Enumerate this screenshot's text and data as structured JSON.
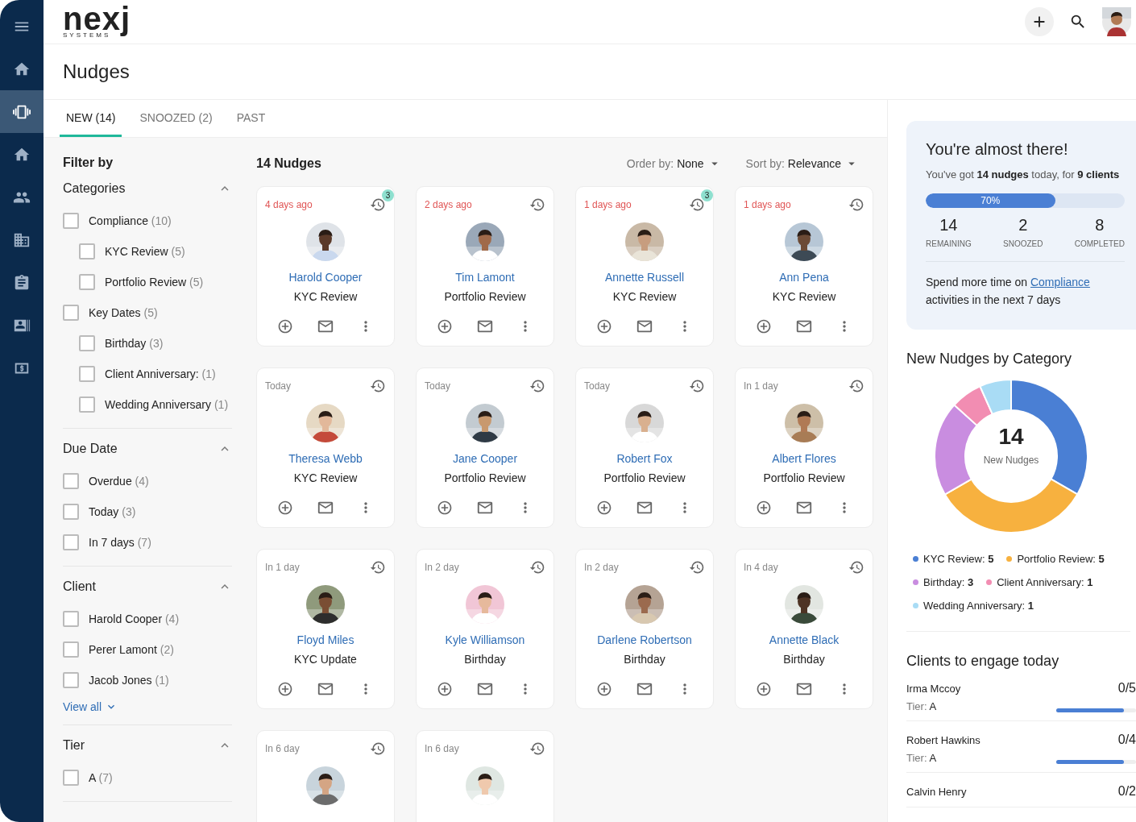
{
  "logo": {
    "word": "nexj",
    "tagline": "SYSTEMS"
  },
  "sidebar": {
    "items": [
      {
        "selected": false
      },
      {
        "selected": true
      },
      {
        "selected": false
      },
      {
        "selected": false
      },
      {
        "selected": false
      },
      {
        "selected": false
      },
      {
        "selected": false
      },
      {
        "selected": false
      }
    ]
  },
  "page_title": "Nudges",
  "tabs": [
    {
      "label": "NEW (14)",
      "selected": true
    },
    {
      "label": "SNOOZED (2)",
      "selected": false
    },
    {
      "label": "PAST",
      "selected": false
    }
  ],
  "filters": {
    "title": "Filter by",
    "sections": [
      {
        "title": "Categories",
        "expanded": true,
        "items": [
          {
            "label": "Compliance",
            "count": "(10)",
            "checked": false,
            "children": [
              {
                "label": "KYC Review",
                "count": "(5)",
                "checked": false
              },
              {
                "label": "Portfolio Review",
                "count": "(5)",
                "checked": false
              }
            ]
          },
          {
            "label": "Key Dates",
            "count": "(5)",
            "checked": false,
            "children": [
              {
                "label": "Birthday",
                "count": "(3)",
                "checked": false
              },
              {
                "label": "Client Anniversary:",
                "count": "(1)",
                "checked": false
              },
              {
                "label": "Wedding Anniversary",
                "count": "(1)",
                "checked": false
              }
            ]
          }
        ]
      },
      {
        "title": "Due Date",
        "expanded": true,
        "items": [
          {
            "label": "Overdue",
            "count": "(4)",
            "checked": false
          },
          {
            "label": "Today",
            "count": "(3)",
            "checked": false
          },
          {
            "label": "In 7 days",
            "count": "(7)",
            "checked": false
          }
        ]
      },
      {
        "title": "Client",
        "expanded": true,
        "items": [
          {
            "label": "Harold Cooper",
            "count": "(4)",
            "checked": false
          },
          {
            "label": "Perer Lamont",
            "count": "(2)",
            "checked": false
          },
          {
            "label": "Jacob Jones",
            "count": "(1)",
            "checked": false
          }
        ],
        "view_all": "View all"
      },
      {
        "title": "Tier",
        "expanded": true,
        "items": [
          {
            "label": "A",
            "count": "(7)",
            "checked": false
          }
        ]
      }
    ]
  },
  "nudges": {
    "title": "14 Nudges",
    "order_label": "Order by:",
    "order_value": "None",
    "sort_label": "Sort by:",
    "sort_value": "Relevance",
    "cards": [
      {
        "due": "4 days ago",
        "overdue": true,
        "badge": "3",
        "name": "Harold Cooper",
        "type": "KYC Review"
      },
      {
        "due": "2 days ago",
        "overdue": true,
        "name": "Tim Lamont",
        "type": "Portfolio Review"
      },
      {
        "due": "1 days ago",
        "overdue": true,
        "badge": "3",
        "name": "Annette Russell",
        "type": "KYC Review"
      },
      {
        "due": "1 days ago",
        "overdue": true,
        "name": "Ann Pena",
        "type": "KYC Review"
      },
      {
        "due": "Today",
        "overdue": false,
        "name": "Theresa Webb",
        "type": "KYC Review"
      },
      {
        "due": "Today",
        "overdue": false,
        "name": "Jane Cooper",
        "type": "Portfolio Review"
      },
      {
        "due": "Today",
        "overdue": false,
        "name": "Robert Fox",
        "type": "Portfolio Review"
      },
      {
        "due": "In 1 day",
        "overdue": false,
        "name": "Albert Flores",
        "type": "Portfolio Review"
      },
      {
        "due": "In 1 day",
        "overdue": false,
        "name": "Floyd Miles",
        "type": "KYC Update"
      },
      {
        "due": "In 2 day",
        "overdue": false,
        "name": "Kyle Williamson",
        "type": "Birthday"
      },
      {
        "due": "In 2 day",
        "overdue": false,
        "name": "Darlene Robertson",
        "type": "Birthday"
      },
      {
        "due": "In 4 day",
        "overdue": false,
        "name": "Annette Black",
        "type": "Birthday"
      },
      {
        "due": "In 6 day",
        "overdue": false
      },
      {
        "due": "In 6 day",
        "overdue": false
      }
    ]
  },
  "summary": {
    "title": "You're almost there!",
    "text": "You've got **14 nudges** today, for **9 clients**",
    "progress": {
      "level": 0.65,
      "reading": "70%"
    },
    "stats": [
      {
        "value": "14",
        "label": "REMAINING"
      },
      {
        "value": "2",
        "label": "SNOOZED"
      },
      {
        "value": "8",
        "label": "COMPLETED"
      }
    ],
    "tip_before": "Spend more time on",
    "tip_link": "Compliance",
    "tip_after": "activities in the next 7 days"
  },
  "category_chart": {
    "title": "New Nudges by Category",
    "center_value": "14",
    "center_label": "New Nudges",
    "chart_data": {
      "type": "donut",
      "values": [
        33.33,
        33.33,
        20,
        6.67,
        6.67
      ]
    },
    "legend": [
      {
        "label": "KYC Review:",
        "value": "5",
        "color": "#4a7fd4"
      },
      {
        "label": "Portfolio Review:",
        "value": "5",
        "color": "#f7b13f"
      },
      {
        "label": "Birthday:",
        "value": "3",
        "color": "#c98de0"
      },
      {
        "label": "Client Anniversary:",
        "value": "1",
        "color": "#f28db2"
      },
      {
        "label": "Wedding Anniversary:",
        "value": "1",
        "color": "#a9dcf5"
      }
    ]
  },
  "clients": {
    "title": "Clients to engage today",
    "items": [
      {
        "name": "Irma Mccoy",
        "tier_label": "Tier:",
        "tier": "A",
        "count": "0/5",
        "level": 0.85
      },
      {
        "name": "Robert Hawkins",
        "tier_label": "Tier:",
        "tier": "A",
        "count": "0/4",
        "level": 0.85
      },
      {
        "name": "Calvin Henry",
        "count": "0/2"
      }
    ]
  }
}
